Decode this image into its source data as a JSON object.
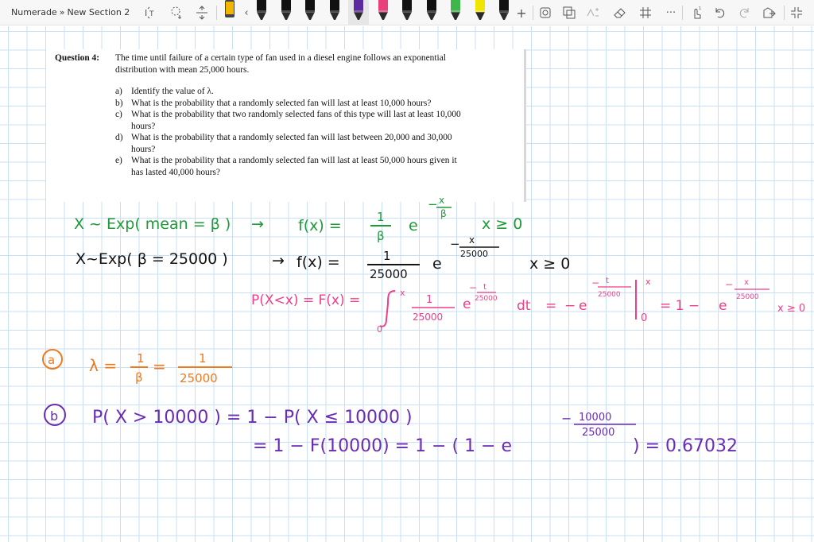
{
  "app": {
    "breadcrumb": {
      "notebook": "Numerade",
      "separator": "»",
      "section": "New Section 2"
    }
  },
  "toolbar": {
    "tools": [
      "text-select-icon",
      "lasso-icon",
      "insert-space-icon"
    ],
    "pens": [
      {
        "name": "pen-gold",
        "color": "#f2b600"
      },
      {
        "name": "pen-black-1",
        "color": "#111111"
      },
      {
        "name": "pen-black-2",
        "color": "#111111"
      },
      {
        "name": "pen-black-3",
        "color": "#111111"
      },
      {
        "name": "pen-black-4",
        "color": "#111111"
      },
      {
        "name": "pen-purple",
        "color": "#5b2aa0",
        "selected": true
      },
      {
        "name": "pen-pink",
        "color": "#e8407a"
      },
      {
        "name": "pen-black-5",
        "color": "#111111"
      },
      {
        "name": "pen-black-6",
        "color": "#111111"
      },
      {
        "name": "pen-green",
        "color": "#3fb64a"
      },
      {
        "name": "pen-yellow",
        "color": "#f0e400"
      },
      {
        "name": "pen-black-7",
        "color": "#111111"
      }
    ],
    "right_tools": [
      "add-pen-icon",
      "ruler-icon",
      "shapes-icon",
      "ink-to-math-icon",
      "eraser-icon",
      "grid-icon",
      "more-icon",
      "touch-icon",
      "undo-icon",
      "redo-icon",
      "share-icon",
      "fullscreen-icon"
    ]
  },
  "question": {
    "label": "Question 4:",
    "intro": "The time until failure of a certain type of fan used in a diesel engine follows an exponential distribution with mean 25,000 hours.",
    "items": [
      {
        "letter": "a)",
        "text": "Identify the value of λ."
      },
      {
        "letter": "b)",
        "text": "What is the probability that a randomly selected fan will last at least 10,000 hours?"
      },
      {
        "letter": "c)",
        "text": "What is the probability that two randomly selected fans of this type will last at least 10,000 hours?"
      },
      {
        "letter": "d)",
        "text": "What is the probability that a randomly selected fan will last between 20,000 and 30,000 hours?"
      },
      {
        "letter": "e)",
        "text": "What is the probability that a randomly selected fan will last at least 50,000 hours given it has lasted 40,000 hours?"
      }
    ]
  },
  "ink": {
    "colors": {
      "green": "#1f9a3a",
      "black": "#141414",
      "pink": "#ee3f8a",
      "orange": "#ee7a1e",
      "purple": "#6a2cb3"
    },
    "line1": {
      "lhs": "X ~ Exp( mean = β )",
      "arrow": "→",
      "f": "f(x) =",
      "num": "1",
      "den": "β",
      "e": "e",
      "exp": "−",
      "exp_num": "x",
      "exp_den": "β",
      "cond": "x ≥ 0"
    },
    "line2": {
      "lhs": "X~Exp( β = 25000 )",
      "arrow": "→",
      "f": "f(x) =",
      "num": "1",
      "den": "25000",
      "e": "e",
      "exp": "−",
      "exp_num": "x",
      "exp_den": "25000",
      "cond": "x ≥ 0"
    },
    "line3": {
      "lhs": "P(X<x) = F(x) =",
      "int_upper": "x",
      "int_lower": "0",
      "num": "1",
      "den": "25000",
      "e": "e",
      "exp": "−",
      "exp_num": "t",
      "exp_den": "25000",
      "dt": "dt",
      "eq": "=",
      "minus": "−",
      "e2": "e",
      "exp2_num": "t",
      "exp2_den": "25000",
      "bar_upper": "x",
      "bar_lower": "0",
      "eq2": "= 1 −",
      "e3": "e",
      "exp3_num": "x",
      "exp3_den": "25000",
      "cond": "x ≥ 0"
    },
    "part_a": {
      "label": "a",
      "lambda": "λ =",
      "num1": "1",
      "den1": "β",
      "eq": "=",
      "num2": "1",
      "den2": "25000"
    },
    "part_b": {
      "label": "b",
      "line1": "P( X > 10000 ) = 1 − P( X ≤ 10000 )",
      "line2_a": "= 1 − F(10000) = 1 − ( 1 − e",
      "exp_num": "10000",
      "exp_den": "25000",
      "exp_sign": "−",
      "line2_b": ") = 0.67032"
    }
  }
}
